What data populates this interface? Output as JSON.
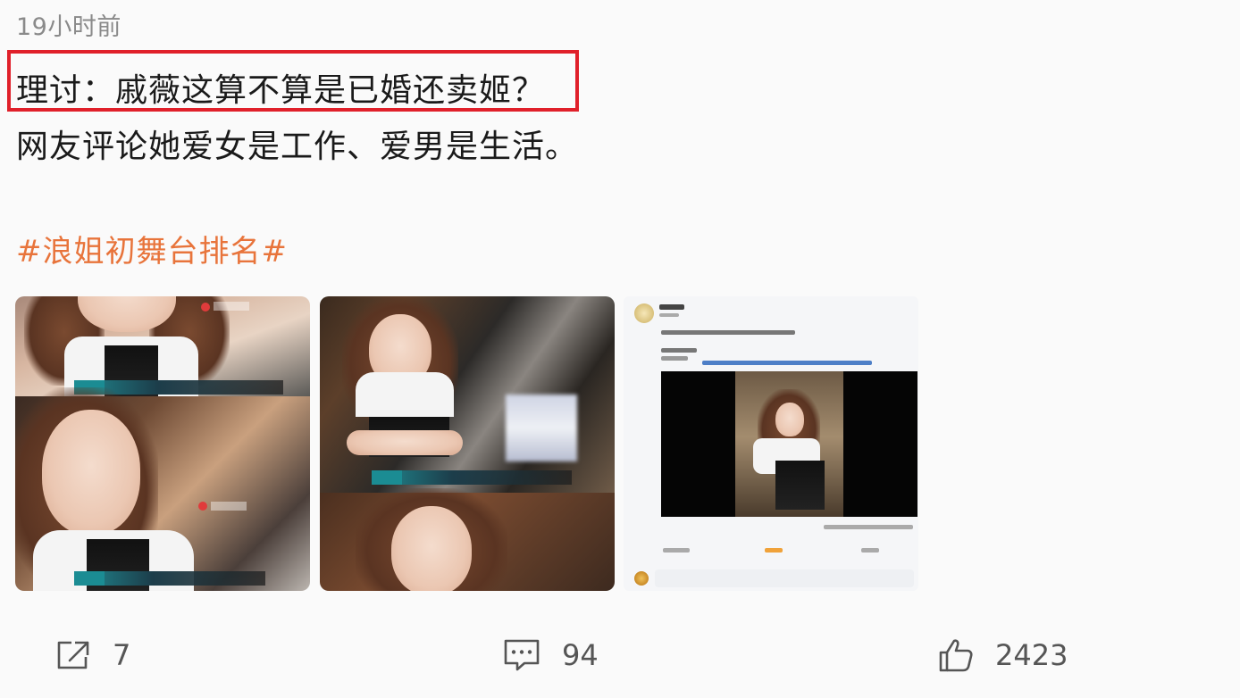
{
  "post": {
    "timestamp": "19小时前",
    "title_line": "理讨：戚薇这算不算是已婚还卖姬？",
    "body_line": "网友评论她爱女是工作、爱男是生活。",
    "hashtag": "#浪姐初舞台排名#"
  },
  "colors": {
    "highlight_border": "#e0202a",
    "hashtag": "#e8743b",
    "timestamp": "#8a8a8a",
    "action_text": "#555555"
  },
  "images": [
    {
      "alt": "戚薇综艺截图1"
    },
    {
      "alt": "戚薇综艺截图2"
    },
    {
      "alt": "微博视频截图"
    }
  ],
  "actions": {
    "share": {
      "icon": "share-icon",
      "count": "7"
    },
    "comment": {
      "icon": "comment-icon",
      "count": "94"
    },
    "like": {
      "icon": "thumbs-up-icon",
      "count": "2423"
    }
  }
}
